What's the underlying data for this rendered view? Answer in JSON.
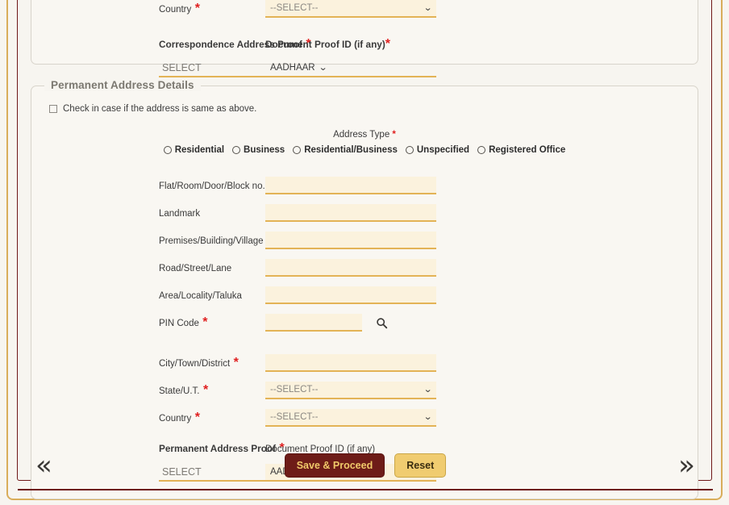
{
  "correspondence_section": {
    "country": {
      "label": "Country",
      "required": true,
      "value": "--SELECT--"
    },
    "address_proof": {
      "label": "Correspondence Address Proof",
      "required": true,
      "value": "SELECT"
    },
    "document_proof_id": {
      "label": "Document Proof ID (if any)",
      "required": true,
      "value": "AADHAAR"
    }
  },
  "permanent_section": {
    "legend": "Permanent Address Details",
    "same_as_above_checkbox": {
      "label": "Check in case if the address is same as above.",
      "checked": false
    },
    "address_type": {
      "label": "Address Type",
      "required": true,
      "options": [
        "Residential",
        "Business",
        "Residential/Business",
        "Unspecified",
        "Registered Office"
      ],
      "selected": ""
    },
    "fields": [
      {
        "label": "Flat/Room/Door/Block no.",
        "required": true,
        "value": "",
        "type": "text"
      },
      {
        "label": "Landmark",
        "required": false,
        "value": "",
        "type": "text"
      },
      {
        "label": "Premises/Building/Village",
        "required": false,
        "value": "",
        "type": "text"
      },
      {
        "label": "Road/Street/Lane",
        "required": false,
        "value": "",
        "type": "text"
      },
      {
        "label": "Area/Locality/Taluka",
        "required": false,
        "value": "",
        "type": "text"
      },
      {
        "label": "PIN Code",
        "required": true,
        "value": "",
        "type": "pincode"
      },
      {
        "label": "City/Town/District",
        "required": true,
        "value": "",
        "type": "text"
      },
      {
        "label": "State/U.T.",
        "required": true,
        "value": "--SELECT--",
        "type": "select"
      },
      {
        "label": "Country",
        "required": true,
        "value": "--SELECT--",
        "type": "select"
      }
    ],
    "address_proof": {
      "label": "Permanent Address Proof",
      "required": true,
      "value": "SELECT"
    },
    "document_proof_id": {
      "label": "Document Proof ID (if any)",
      "required": false,
      "value": "AADHAAR"
    }
  },
  "footer": {
    "prev_label": "«",
    "next_label": "»",
    "save_label": "Save & Proceed",
    "reset_label": "Reset"
  },
  "icons": {
    "search": "search-icon",
    "chevron_down": "⌄"
  },
  "colors": {
    "accent_gold": "#e3b356",
    "field_fill": "#fbf2dd",
    "primary_button": "#6e1c18",
    "primary_button_text": "#f0c96a",
    "secondary_button": "#f0cc70",
    "frame_maroon": "#6e1717",
    "required_star": "#e02020",
    "page_bg": "#f7f5f0"
  }
}
